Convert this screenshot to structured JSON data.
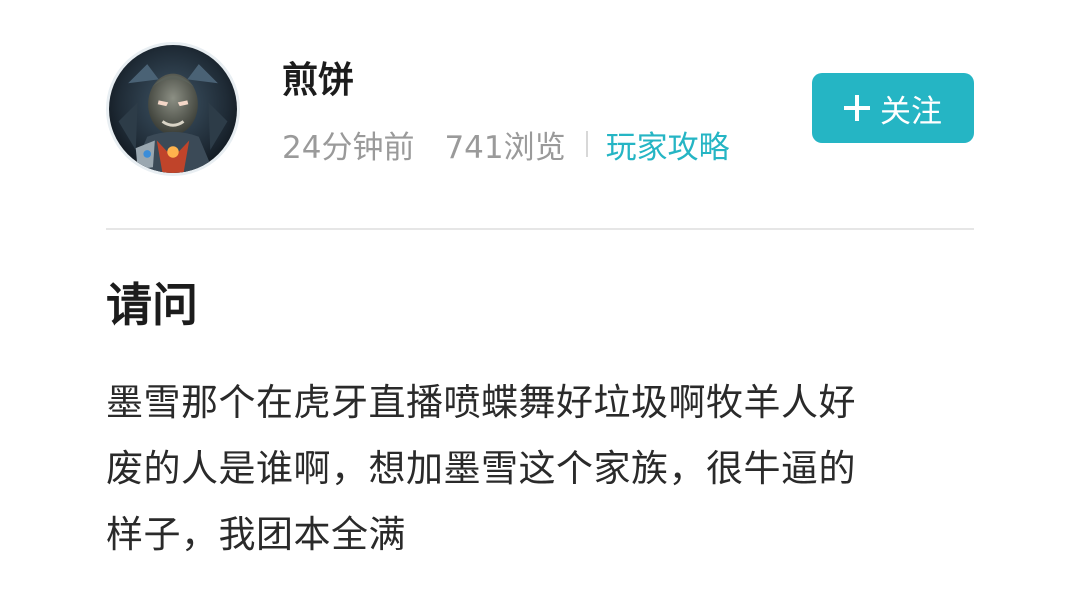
{
  "author": {
    "name": "煎饼",
    "avatar_icon": "robot-avatar"
  },
  "meta": {
    "time": "24分钟前",
    "views": "741浏览",
    "category": "玩家攻略"
  },
  "follow_button": {
    "label": "关注",
    "icon": "plus-icon"
  },
  "post": {
    "title": "请问",
    "body_lines": [
      "墨雪那个在虎牙直播喷蝶舞好垃圾啊牧羊人好",
      "废的人是谁啊，想加墨雪这个家族，很牛逼的",
      "样子，我团本全满"
    ]
  },
  "colors": {
    "accent": "#25b5c4",
    "meta_text": "#9a9a9a",
    "title_text": "#1c1c1c"
  }
}
